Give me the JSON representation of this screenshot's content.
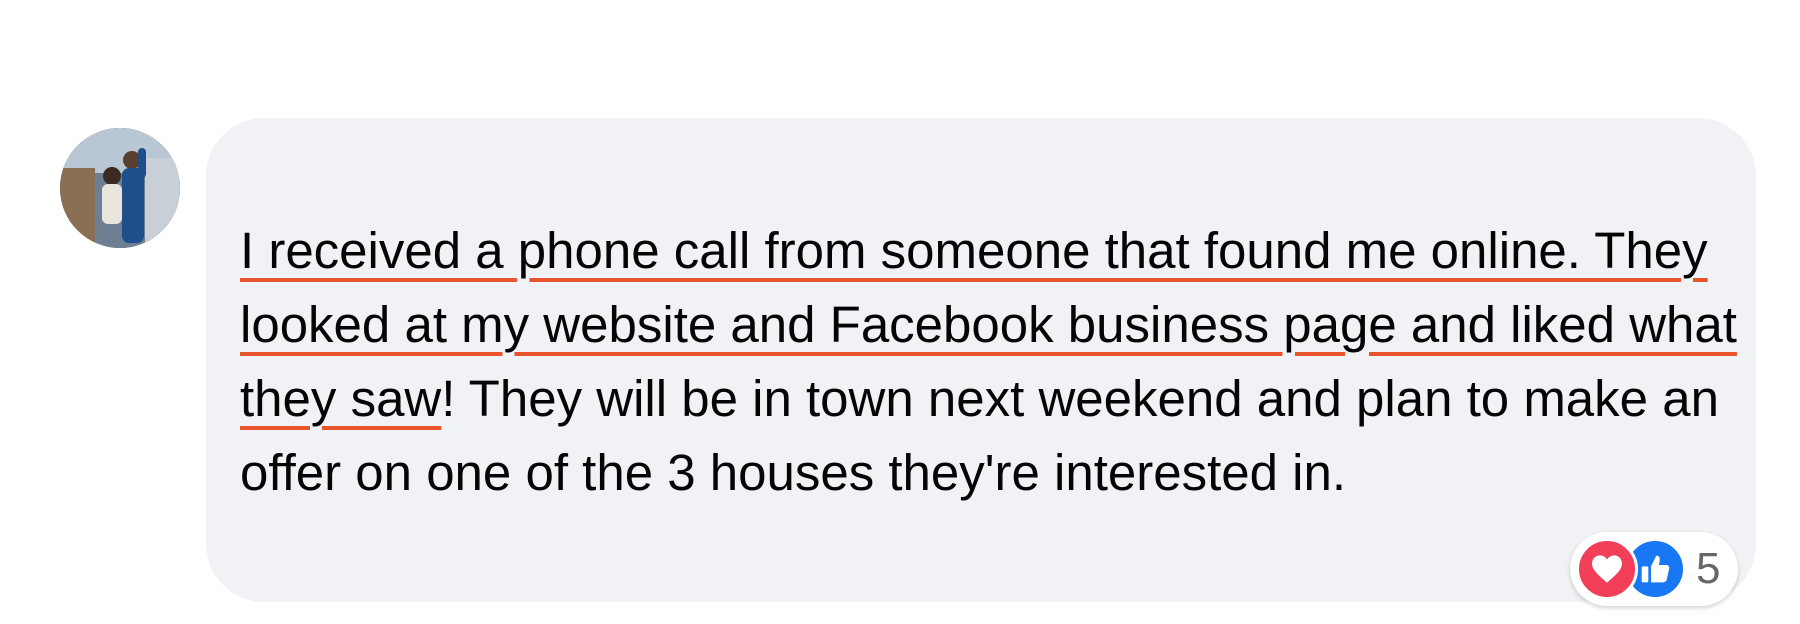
{
  "comment": {
    "highlighted_text": "I received a phone call from someone that found me online. They looked at my website and Facebook business page and liked what they saw",
    "remaining_text": "! They will be in town next weekend and plan to make an offer on one of the 3 houses they're interested in."
  },
  "reactions": {
    "icons": [
      "heart-icon",
      "thumbs-up-icon"
    ],
    "count": "5"
  },
  "colors": {
    "bubble": "#f0f2f5",
    "underline": "#e8552d",
    "love": "#f33e58",
    "like": "#1877f2"
  }
}
